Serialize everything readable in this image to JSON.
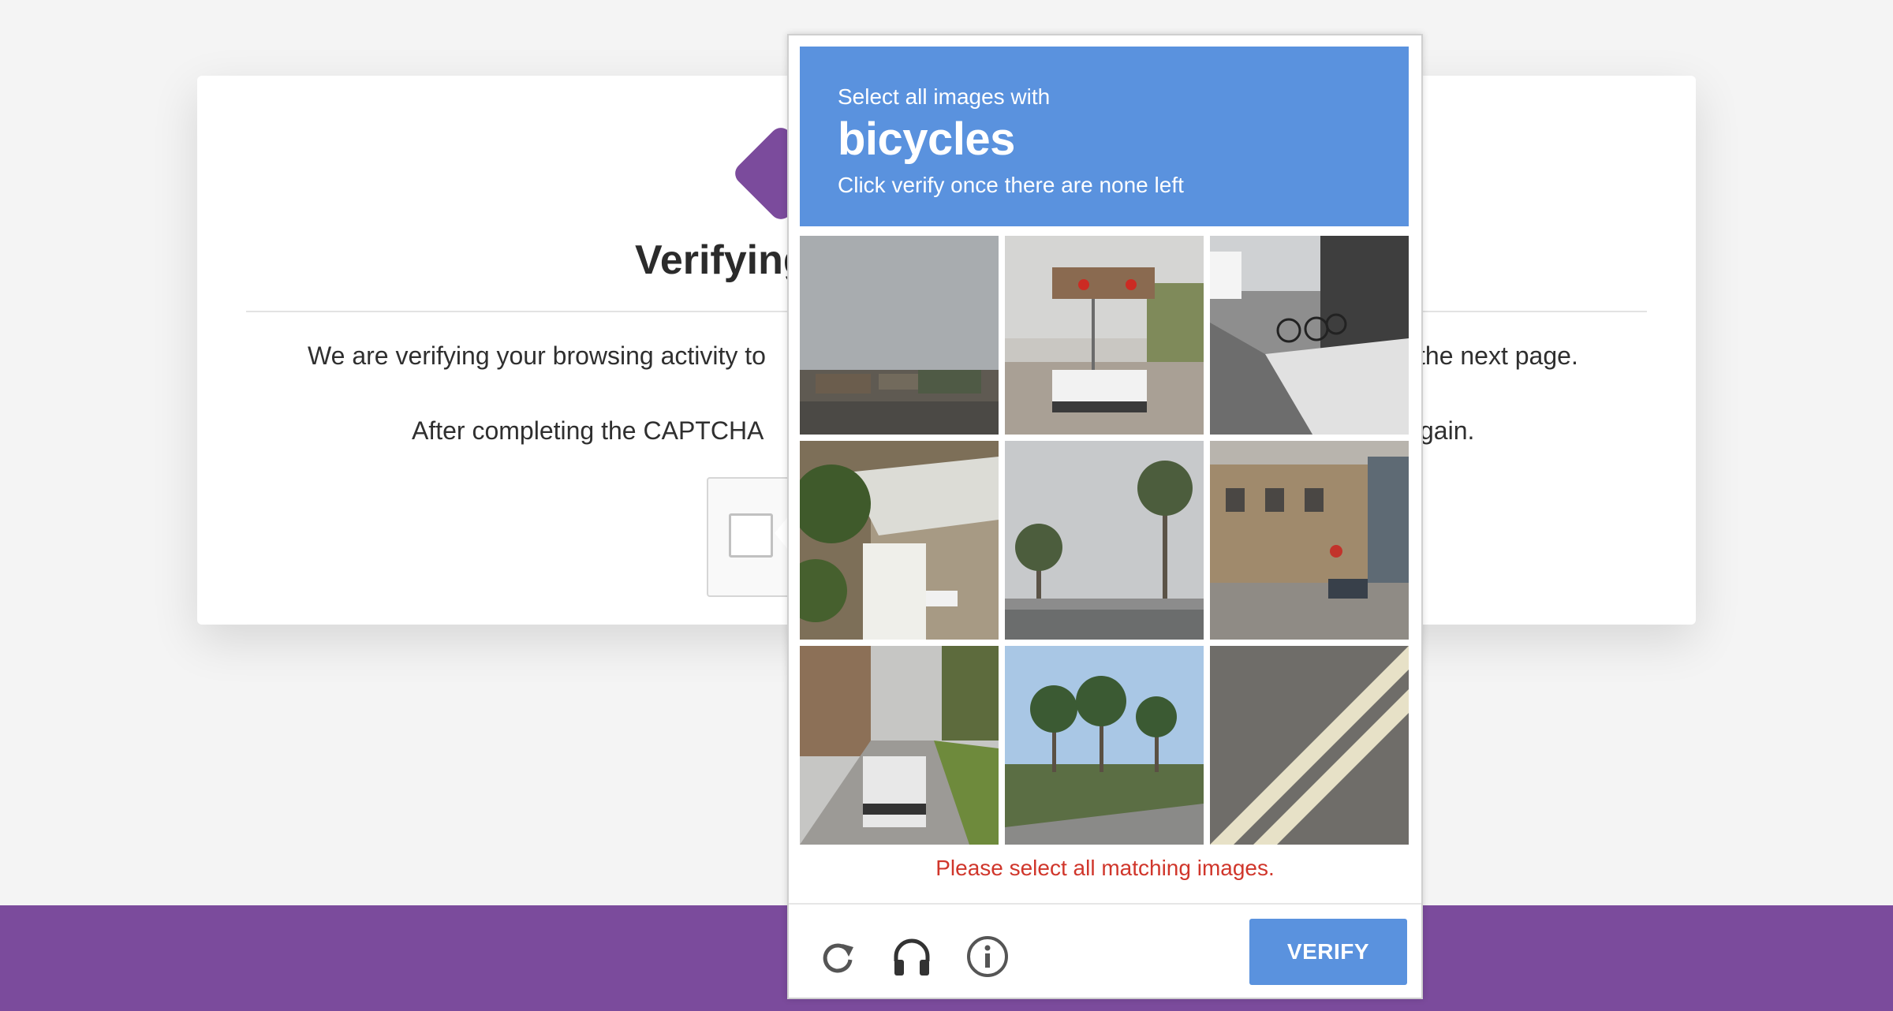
{
  "page": {
    "title": "Verifying",
    "para1_left": "We are verifying your browsing activity to",
    "para1_right": "the next page.",
    "para2_left": "After completing the CAPTCHA",
    "para2_right": "gain.",
    "brand_color": "#7b4b9c"
  },
  "challenge": {
    "instruction": "Select all images with",
    "target": "bicycles",
    "subtext": "Click verify once there are none left",
    "tiles": [
      {
        "icon": "street-horizon-image"
      },
      {
        "icon": "traffic-light-truck-image"
      },
      {
        "icon": "parked-bicycles-sidewalk-image"
      },
      {
        "icon": "house-awning-image"
      },
      {
        "icon": "palm-trees-road-image"
      },
      {
        "icon": "brick-building-street-image"
      },
      {
        "icon": "road-car-trees-image"
      },
      {
        "icon": "palm-trees-field-image"
      },
      {
        "icon": "road-markings-image"
      }
    ],
    "error": "Please select all matching images.",
    "verify_label": "VERIFY",
    "accent_color": "#5a92de",
    "error_color": "#d0362b"
  }
}
